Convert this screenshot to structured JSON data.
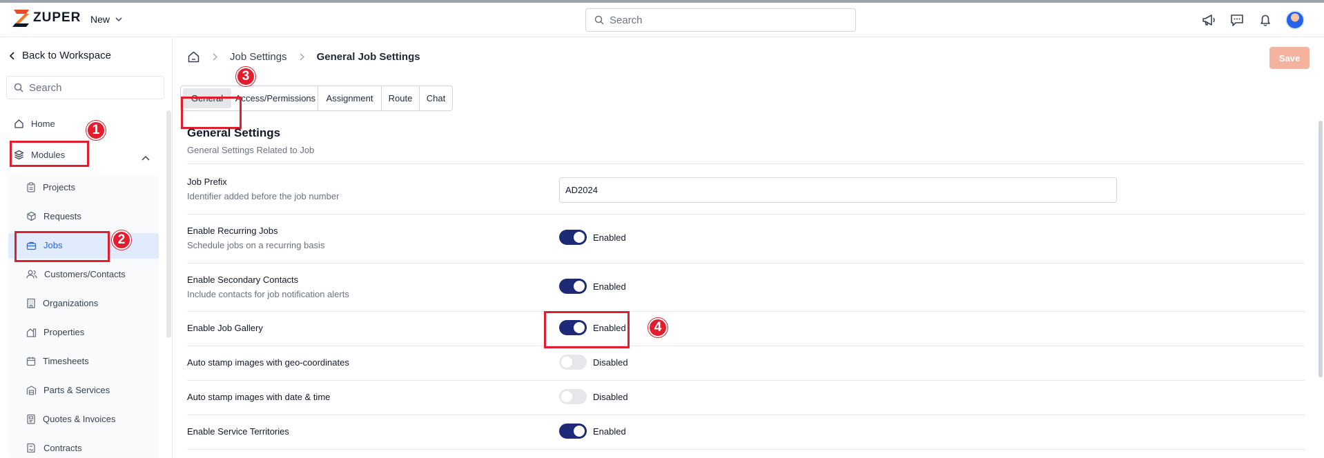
{
  "app": {
    "brand": "ZUPER",
    "new_label": "New"
  },
  "top_search": {
    "placeholder": "Search"
  },
  "sidebar": {
    "back_label": "Back to Workspace",
    "search_placeholder": "Search",
    "home_label": "Home",
    "modules_label": "Modules",
    "items": [
      {
        "label": "Projects",
        "icon": "clipboard-icon"
      },
      {
        "label": "Requests",
        "icon": "box-icon"
      },
      {
        "label": "Jobs",
        "icon": "briefcase-icon"
      },
      {
        "label": "Customers/Contacts",
        "icon": "users-icon"
      },
      {
        "label": "Organizations",
        "icon": "building-icon"
      },
      {
        "label": "Properties",
        "icon": "property-icon"
      },
      {
        "label": "Timesheets",
        "icon": "calendar-icon"
      },
      {
        "label": "Parts & Services",
        "icon": "warehouse-icon"
      },
      {
        "label": "Quotes & Invoices",
        "icon": "invoice-icon"
      },
      {
        "label": "Contracts",
        "icon": "contract-icon"
      }
    ]
  },
  "breadcrumb": {
    "parent": "Job Settings",
    "current": "General Job Settings"
  },
  "save_label": "Save",
  "tabs": [
    "General",
    "Access/Permissions",
    "Assignment",
    "Route",
    "Chat"
  ],
  "section": {
    "title": "General Settings",
    "subtitle": "General Settings Related to Job"
  },
  "settings": {
    "job_prefix": {
      "label": "Job Prefix",
      "desc": "Identifier added before the job number",
      "value": "AD2024"
    },
    "recurring": {
      "label": "Enable Recurring Jobs",
      "desc": "Schedule jobs on a recurring basis",
      "state": "Enabled"
    },
    "secondary": {
      "label": "Enable Secondary Contacts",
      "desc": "Include contacts for job notification alerts",
      "state": "Enabled"
    },
    "gallery": {
      "label": "Enable Job Gallery",
      "state": "Enabled"
    },
    "geo": {
      "label": "Auto stamp images with geo-coordinates",
      "state": "Disabled"
    },
    "datetime": {
      "label": "Auto stamp images with date & time",
      "state": "Disabled"
    },
    "territories": {
      "label": "Enable Service Territories",
      "state": "Enabled"
    }
  },
  "annotations": [
    "1",
    "2",
    "3",
    "4"
  ],
  "colors": {
    "toggle_on": "#1e2a78",
    "save_button": "#f3b39f",
    "annotation": "#e11d2e",
    "active_nav": "#e0ecfb"
  }
}
